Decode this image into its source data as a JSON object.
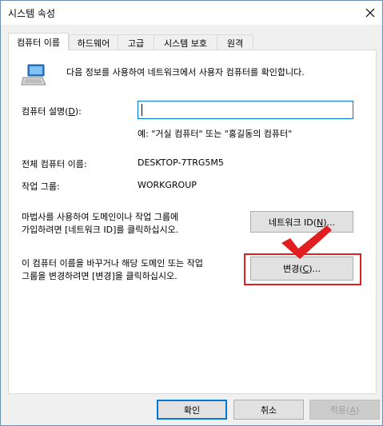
{
  "window": {
    "title": "시스템 속성"
  },
  "tabs": [
    {
      "label": "컴퓨터 이름"
    },
    {
      "label": "하드웨어"
    },
    {
      "label": "고급"
    },
    {
      "label": "시스템 보호"
    },
    {
      "label": "원격"
    }
  ],
  "main": {
    "intro_text": "다음 정보를 사용하여 네트워크에서 사용자 컴퓨터를 확인합니다.",
    "description_label_prefix": "컴퓨터 설명(",
    "description_label_key": "D",
    "description_label_suffix": "):",
    "description_value": "",
    "description_example": "예: \"거실 컴퓨터\" 또는 \"홍길동의 컴퓨터\"",
    "full_name_label": "전체 컴퓨터 이름:",
    "full_name_value": "DESKTOP-7TRG5M5",
    "workgroup_label": "작업 그룹:",
    "workgroup_value": "WORKGROUP",
    "wizard_text_line1": "마법사를 사용하여 도메인이나 작업 그룹에",
    "wizard_text_line2": "가입하려면 [네트워크 ID]를 클릭하십시오.",
    "network_id_button": {
      "prefix": "네트워크 ID(",
      "key": "N",
      "suffix": ")..."
    },
    "rename_text_line1": "이 컴퓨터 이름을 바꾸거나 해당 도메인 또는 작업",
    "rename_text_line2": "그룹을 변경하려면 [변경]을 클릭하십시오.",
    "change_button": {
      "prefix": "변경(",
      "key": "C",
      "suffix": ")..."
    }
  },
  "footer": {
    "ok_label": "확인",
    "cancel_label": "취소",
    "apply": {
      "prefix": "적용(",
      "key": "A",
      "suffix": ")"
    }
  },
  "colors": {
    "accent": "#0078d7",
    "annotation": "#e02020"
  },
  "icons": {
    "computer": "computer-icon",
    "close": "close-icon",
    "checkmark": "checkmark-annotation-icon"
  }
}
